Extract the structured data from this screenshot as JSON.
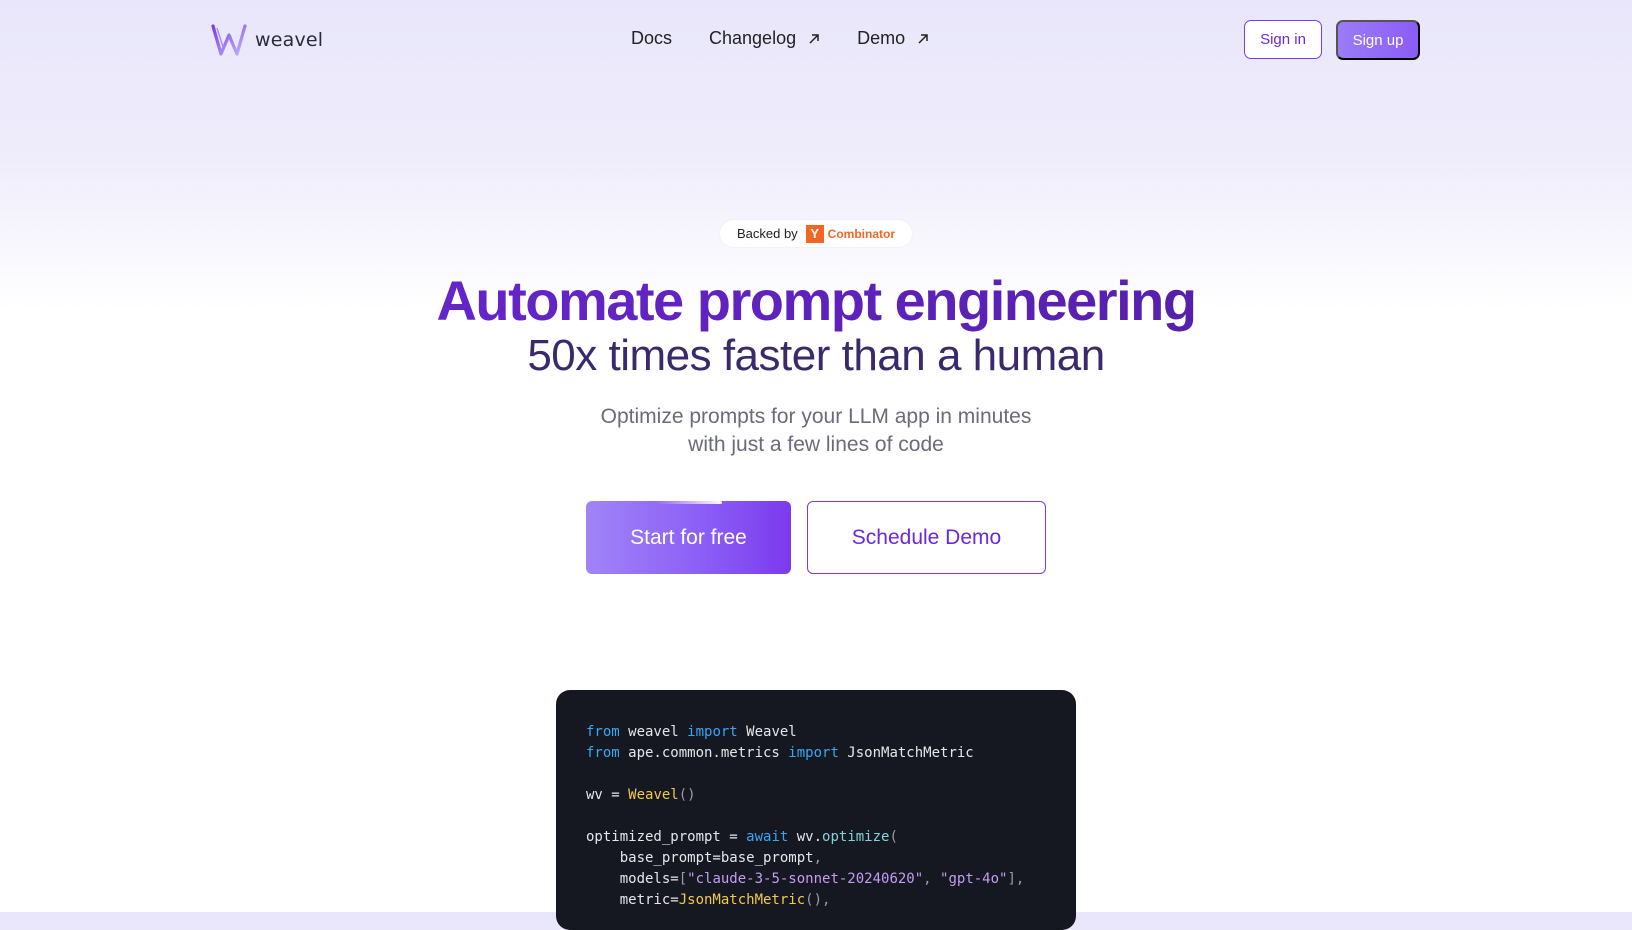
{
  "nav": {
    "logo_text": "weavel",
    "links": [
      {
        "label": "Docs",
        "external": false
      },
      {
        "label": "Changelog",
        "external": true
      },
      {
        "label": "Demo",
        "external": true
      }
    ],
    "sign_in": "Sign in",
    "sign_up": "Sign up"
  },
  "hero": {
    "badge_prefix": "Backed by",
    "badge_logo_letter": "Y",
    "badge_brand": "Combinator",
    "title": "Automate prompt engineering",
    "subtitle": "50x times faster than a human",
    "description_line1": "Optimize prompts for your LLM app in minutes",
    "description_line2": "with just a few lines of code",
    "cta_primary": "Start for free",
    "cta_secondary": "Schedule Demo"
  },
  "code": {
    "l1": {
      "kw1": "from",
      "mod": " weavel ",
      "kw2": "import",
      "name": " Weavel"
    },
    "l2": {
      "kw1": "from",
      "mod": " ape.common.metrics ",
      "kw2": "import",
      "name": " JsonMatchMetric"
    },
    "l4": {
      "var": "wv = ",
      "cls": "Weavel",
      "punc": "()"
    },
    "l6": {
      "var": "optimized_prompt = ",
      "kw": "await",
      "obj": " wv.",
      "fn": "optimize",
      "punc": "("
    },
    "l7": {
      "text": "    base_prompt=base_prompt",
      "punc": ","
    },
    "l8": {
      "key": "    models=",
      "open": "[",
      "s1": "\"claude-3-5-sonnet-20240620\"",
      "sep": ", ",
      "s2": "\"gpt-4o\"",
      "close": "],"
    },
    "l9": {
      "key": "    metric=",
      "cls": "JsonMatchMetric",
      "punc": "(),"
    }
  },
  "colors": {
    "accent": "#7c3aed",
    "title_purple": "#6d28d9",
    "yc_orange": "#f26625",
    "code_bg": "#161821"
  }
}
